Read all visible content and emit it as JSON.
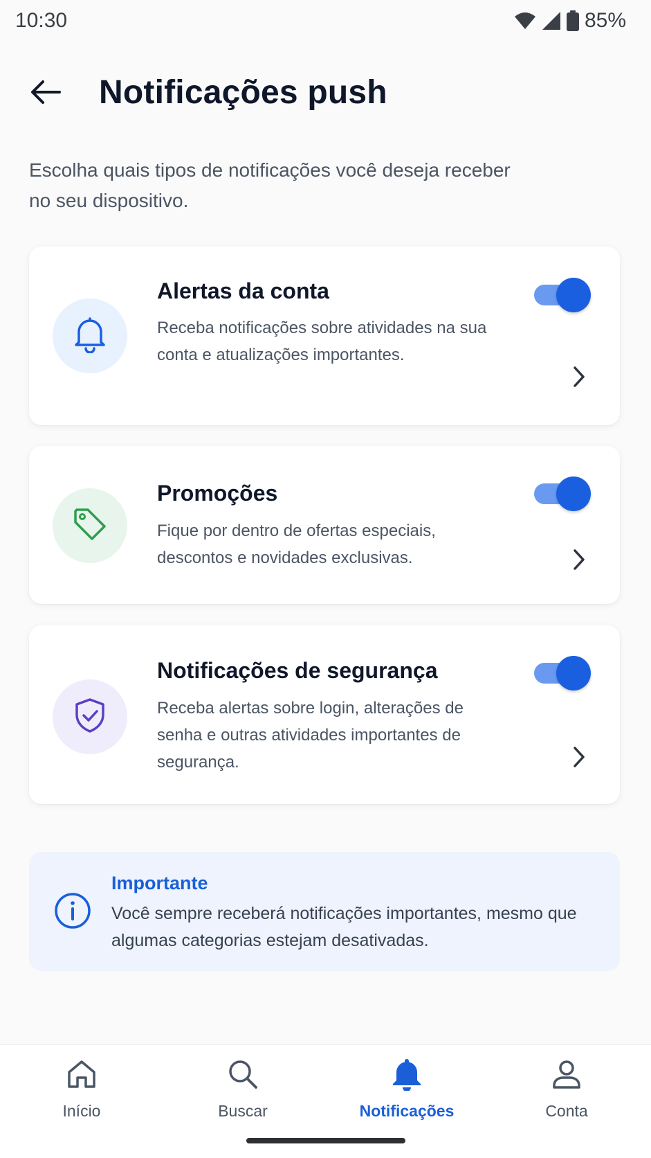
{
  "status_bar": {
    "time": "10:30",
    "battery": "85%",
    "icons": [
      "wifi-icon",
      "cellular-signal-icon",
      "battery-icon"
    ]
  },
  "header": {
    "back_icon": "arrow-left-icon",
    "title": "Notificações push"
  },
  "intro_text": "Escolha quais tipos de notificações você deseja receber no seu dispositivo.",
  "cards": [
    {
      "icon": "bell-icon",
      "icon_color": "#1a5fe0",
      "icon_bg": "#e8f1fe",
      "title": "Alertas da conta",
      "description": "Receba notificações sobre atividades na sua conta e atualizações importantes.",
      "enabled": true
    },
    {
      "icon": "tag-icon",
      "icon_color": "#2e9e4f",
      "icon_bg": "#e8f5ec",
      "title": "Promoções",
      "description": "Fique por dentro de ofertas especiais, descontos e novidades exclusivas.",
      "enabled": true
    },
    {
      "icon": "shield-check-icon",
      "icon_color": "#5b3fc4",
      "icon_bg": "#efedfb",
      "title": "Notificações de segurança",
      "description": "Receba alertas sobre login, alterações de senha e outras atividades importantes de segurança.",
      "enabled": true
    }
  ],
  "info": {
    "icon": "info-icon",
    "title": "Importante",
    "text": "Você sempre receberá notificações importantes, mesmo que algumas categorias estejam desativadas."
  },
  "bottom_nav": {
    "items": [
      {
        "label": "Início",
        "icon": "home-icon",
        "active": false
      },
      {
        "label": "Buscar",
        "icon": "search-icon",
        "active": false
      },
      {
        "label": "Notificações",
        "icon": "bell-icon",
        "active": true
      },
      {
        "label": "Conta",
        "icon": "user-icon",
        "active": false
      }
    ]
  },
  "colors": {
    "accent": "#1a5fd8",
    "toggle_on_thumb": "#1a5fe0",
    "toggle_on_track": "#6a9af0",
    "info_bg": "#eef3fd"
  }
}
